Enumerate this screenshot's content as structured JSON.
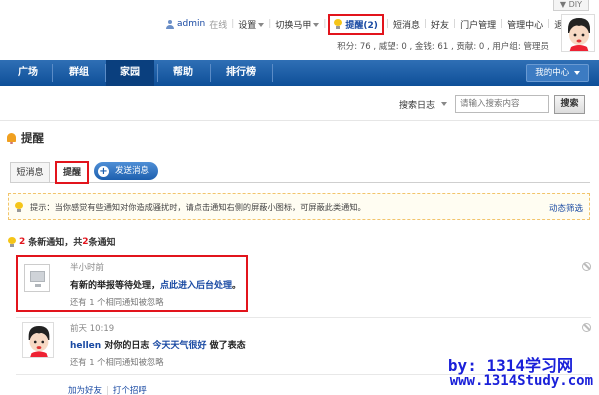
{
  "diy": "DIY",
  "topbar": {
    "username": "admin",
    "online_status": "在线",
    "settings": "设置",
    "switch_vest": "切换马甲",
    "reminders": "提醒(2)",
    "short_messages": "短消息",
    "friends": "好友",
    "portal_manage": "门户管理",
    "manage_center": "管理中心",
    "logout": "退出",
    "stats": "积分: 76 , 威望: 0 , 金钱: 61 , 贡献: 0 , 用户组: 管理员"
  },
  "nav": {
    "items": [
      "广场",
      "群组",
      "家园",
      "帮助",
      "排行榜"
    ],
    "active": "家园",
    "my_center": "我的中心"
  },
  "search": {
    "scope": "搜索日志",
    "placeholder": "请输入搜索内容",
    "button": "搜索"
  },
  "page": {
    "title": "提醒",
    "tabs": [
      "短消息",
      "提醒"
    ],
    "send_button": "发送消息",
    "tip": "提示：当你感觉有些通知对你造成骚扰时，请点击通知右侧的屏蔽小图标，可屏蔽此类通知。",
    "filter_link": "动态筛选",
    "count": {
      "new_count": "2",
      "new_label": "条新通知，共",
      "total": "2",
      "total_label": "条通知"
    }
  },
  "notices": [
    {
      "time": "半小时前",
      "message_prefix": "有新的举报等待处理，",
      "message_link": "点此进入后台处理",
      "message_suffix": "。",
      "similar": "还有 1 个相同通知被忽略"
    },
    {
      "time": "前天 10:19",
      "user": "hellen",
      "message_middle": "对你的日志",
      "blog_title": "今天天气很好",
      "message_suffix": "做了表态",
      "similar": "还有 1 个相同通知被忽略",
      "actions": [
        "加为好友",
        "打个招呼"
      ]
    }
  ],
  "watermark": {
    "line1": "by: 1314学习网",
    "line2": "www.1314Study.com"
  },
  "colors": {
    "nav_blue": "#0e4f98",
    "highlight_red": "#e2141c",
    "link_blue": "#1a4aa3",
    "watermark_blue": "#1a20d9"
  }
}
